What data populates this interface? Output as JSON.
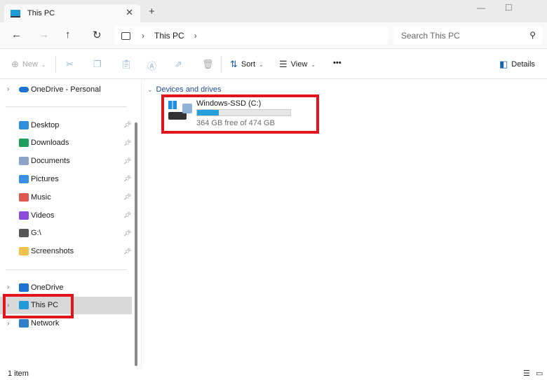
{
  "window": {
    "tab_title": "This PC",
    "new_tab": "+",
    "close_tab": "✕",
    "minimize": "—",
    "maximize": "☐"
  },
  "nav": {
    "back": "←",
    "forward": "→",
    "up": "↑",
    "refresh": "↻",
    "breadcrumb": [
      "This PC"
    ],
    "search_placeholder": "Search This PC"
  },
  "toolbar": {
    "new_label": "New",
    "sort_label": "Sort",
    "view_label": "View",
    "more_label": "•••",
    "details_label": "Details"
  },
  "sidebar": {
    "top": {
      "label": "OneDrive - Personal"
    },
    "quick": [
      {
        "label": "Desktop",
        "color": "#2b8fd9"
      },
      {
        "label": "Downloads",
        "color": "#1a9e5c"
      },
      {
        "label": "Documents",
        "color": "#8aa5c8"
      },
      {
        "label": "Pictures",
        "color": "#3a8ee6"
      },
      {
        "label": "Music",
        "color": "#e0574f"
      },
      {
        "label": "Videos",
        "color": "#8a4bd8"
      },
      {
        "label": "G:\\",
        "color": "#555555"
      },
      {
        "label": "Screenshots",
        "color": "#f2c14e"
      }
    ],
    "bottom": [
      {
        "label": "OneDrive",
        "color": "#1d73d1"
      },
      {
        "label": "This PC",
        "color": "#1e9ad6"
      },
      {
        "label": "Network",
        "color": "#2d7fc9"
      }
    ]
  },
  "main": {
    "group_label": "Devices and drives",
    "drive": {
      "name": "Windows-SSD (C:)",
      "free_text": "364 GB free of 474 GB",
      "used_fraction": 0.232
    }
  },
  "status": {
    "count": "1 item"
  },
  "colors": {
    "highlight": "#e3141c",
    "bar": "#26a0da"
  }
}
